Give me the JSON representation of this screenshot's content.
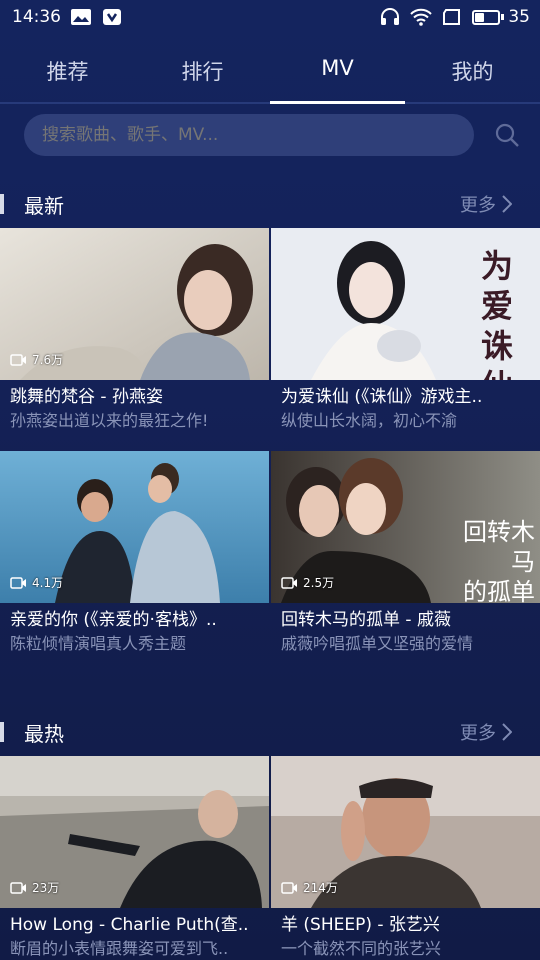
{
  "status": {
    "time": "14:36",
    "battery": "35",
    "battery_fraction": 0.35
  },
  "tabs": [
    {
      "label": "推荐",
      "active": false
    },
    {
      "label": "排行",
      "active": false
    },
    {
      "label": "MV",
      "active": true
    },
    {
      "label": "我的",
      "active": false
    }
  ],
  "search": {
    "placeholder": "搜索歌曲、歌手、MV..."
  },
  "sections": [
    {
      "title": "最新",
      "more": "更多",
      "items": [
        {
          "title": "跳舞的梵谷 - 孙燕姿",
          "subtitle": "孙燕姿出道以来的最狂之作!",
          "views": "7.6万"
        },
        {
          "title": "为爱诛仙 (《诛仙》游戏主..",
          "subtitle": "纵使山长水阔，初心不渝",
          "views": "",
          "thumb_text": "为爱诛仙"
        },
        {
          "title": "亲爱的你 (《亲爱的·客栈》..",
          "subtitle": "陈粒倾情演唱真人秀主题",
          "views": "4.1万"
        },
        {
          "title": "回转木马的孤单 - 戚薇",
          "subtitle": "戚薇吟唱孤单又坚强的爱情",
          "views": "2.5万",
          "thumb_text_1": "回转木马",
          "thumb_text_2": "的孤单"
        }
      ]
    },
    {
      "title": "最热",
      "more": "更多",
      "items": [
        {
          "title": "How Long - Charlie Puth(查..",
          "subtitle": "断眉的小表情跟舞姿可爱到飞..",
          "views": "23万"
        },
        {
          "title": "羊 (SHEEP) - 张艺兴",
          "subtitle": "一个截然不同的张艺兴",
          "views": "214万"
        }
      ]
    }
  ],
  "colors": {
    "background": "#14225a",
    "tab_divider": "#273a7a",
    "search_bg": "#2f3f79",
    "subtitle": "#8a94b8",
    "more": "#7f8bb4"
  }
}
